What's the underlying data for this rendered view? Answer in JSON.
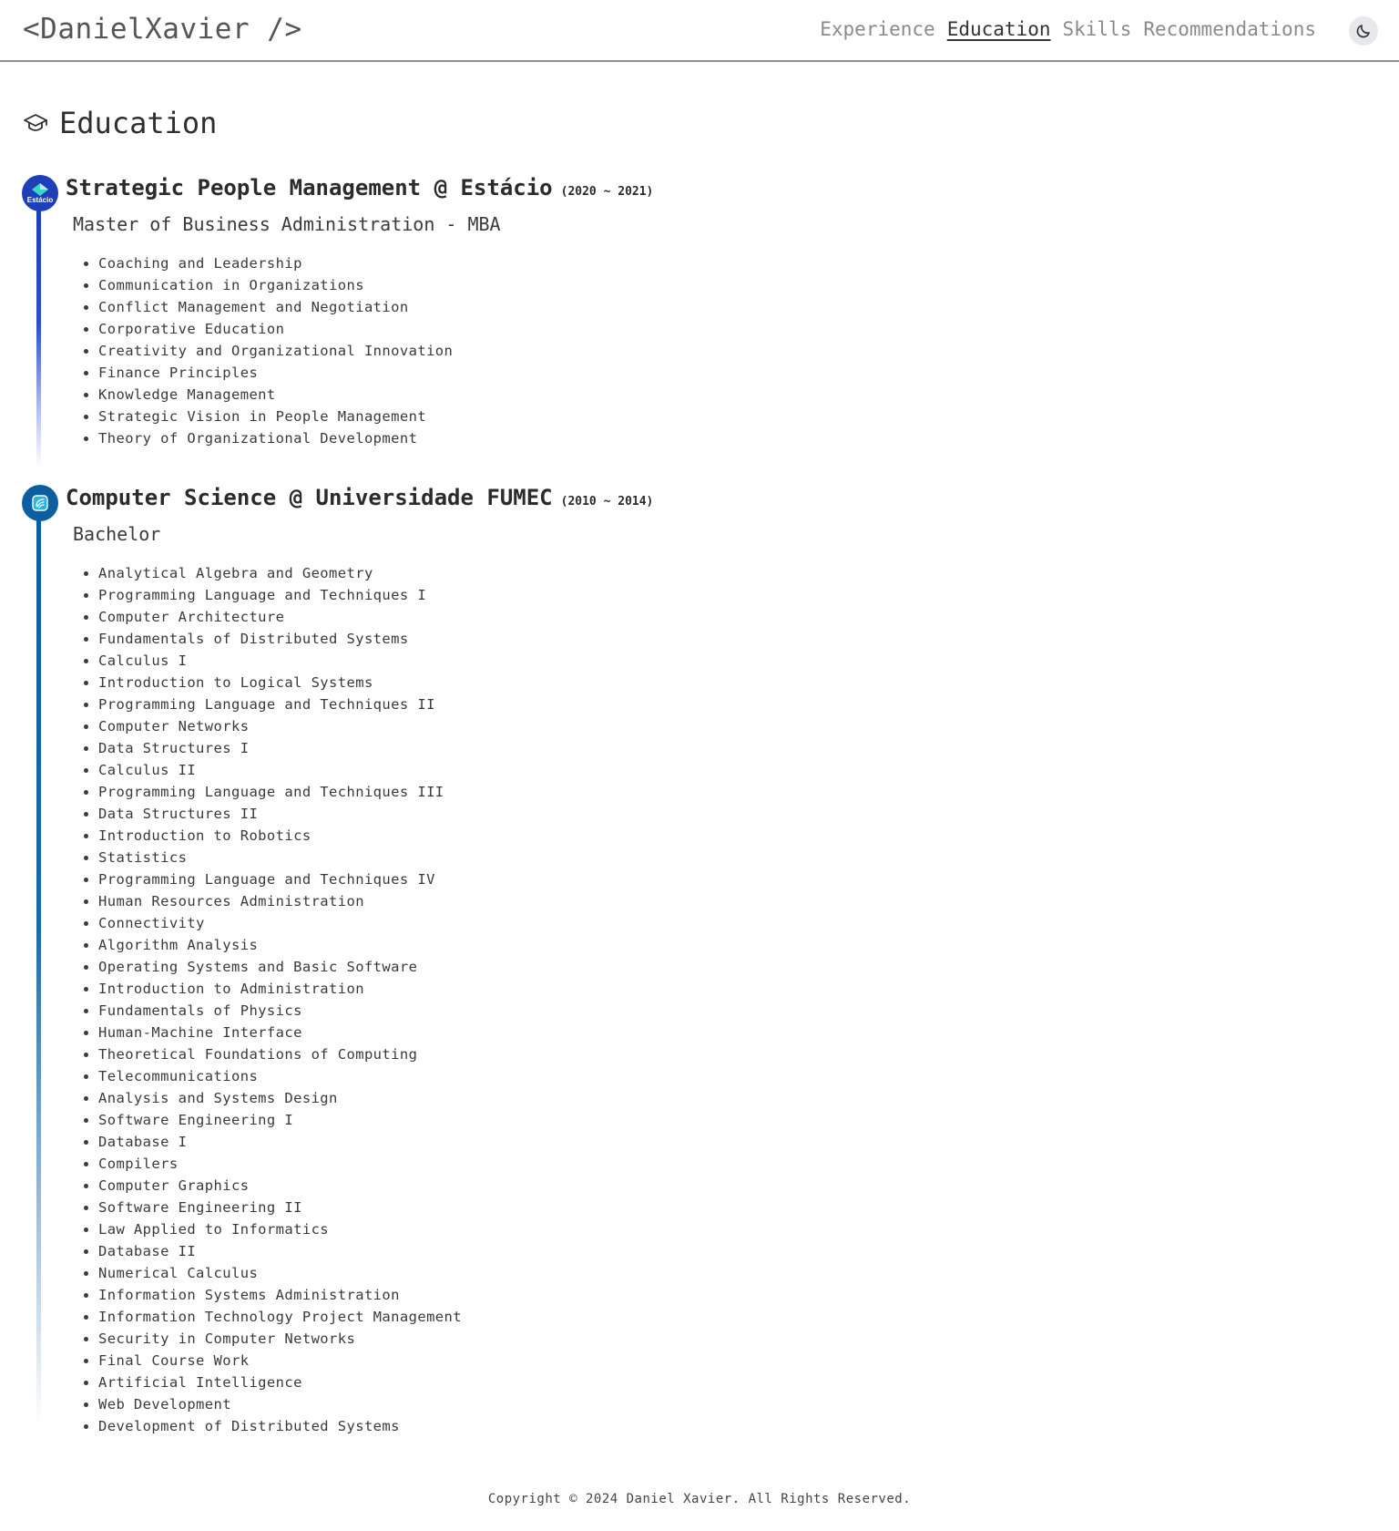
{
  "header": {
    "logo": "<DanielXavier />",
    "nav": [
      "Experience",
      "Education",
      "Skills",
      "Recommendations"
    ],
    "active_nav": "Education",
    "theme_icon": "moon-icon"
  },
  "section": {
    "title": "Education",
    "icon": "graduation-cap-icon"
  },
  "education": [
    {
      "title": "Strategic People Management @ Estácio",
      "years": "(2020 ~ 2021)",
      "degree": "Master of Business Administration - MBA",
      "logo_text": "Estácio",
      "brand_color": "#1e3fb8",
      "courses": [
        "Coaching and Leadership",
        "Communication in Organizations",
        "Conflict Management and Negotiation",
        "Corporative Education",
        "Creativity and Organizational Innovation",
        "Finance Principles",
        "Knowledge Management",
        "Strategic Vision in People Management",
        "Theory of Organizational Development"
      ]
    },
    {
      "title": "Computer Science @ Universidade FUMEC",
      "years": "(2010 ~ 2014)",
      "degree": "Bachelor",
      "brand_color": "#0b5fa0",
      "courses": [
        "Analytical Algebra and Geometry",
        "Programming Language and Techniques I",
        "Computer Architecture",
        "Fundamentals of Distributed Systems",
        "Calculus I",
        "Introduction to Logical Systems",
        "Programming Language and Techniques II",
        "Computer Networks",
        "Data Structures I",
        "Calculus II",
        "Programming Language and Techniques III",
        "Data Structures II",
        "Introduction to Robotics",
        "Statistics",
        "Programming Language and Techniques IV",
        "Human Resources Administration",
        "Connectivity",
        "Algorithm Analysis",
        "Operating Systems and Basic Software",
        "Introduction to Administration",
        "Fundamentals of Physics",
        "Human-Machine Interface",
        "Theoretical Foundations of Computing",
        "Telecommunications",
        "Analysis and Systems Design",
        "Software Engineering I",
        "Database I",
        "Compilers",
        "Computer Graphics",
        "Software Engineering II",
        "Law Applied to Informatics",
        "Database II",
        "Numerical Calculus",
        "Information Systems Administration",
        "Information Technology Project Management",
        "Security in Computer Networks",
        "Final Course Work",
        "Artificial Intelligence",
        "Web Development",
        "Development of Distributed Systems"
      ]
    }
  ],
  "footer": {
    "copyright": "Copyright © 2024 Daniel Xavier. All Rights Reserved."
  }
}
